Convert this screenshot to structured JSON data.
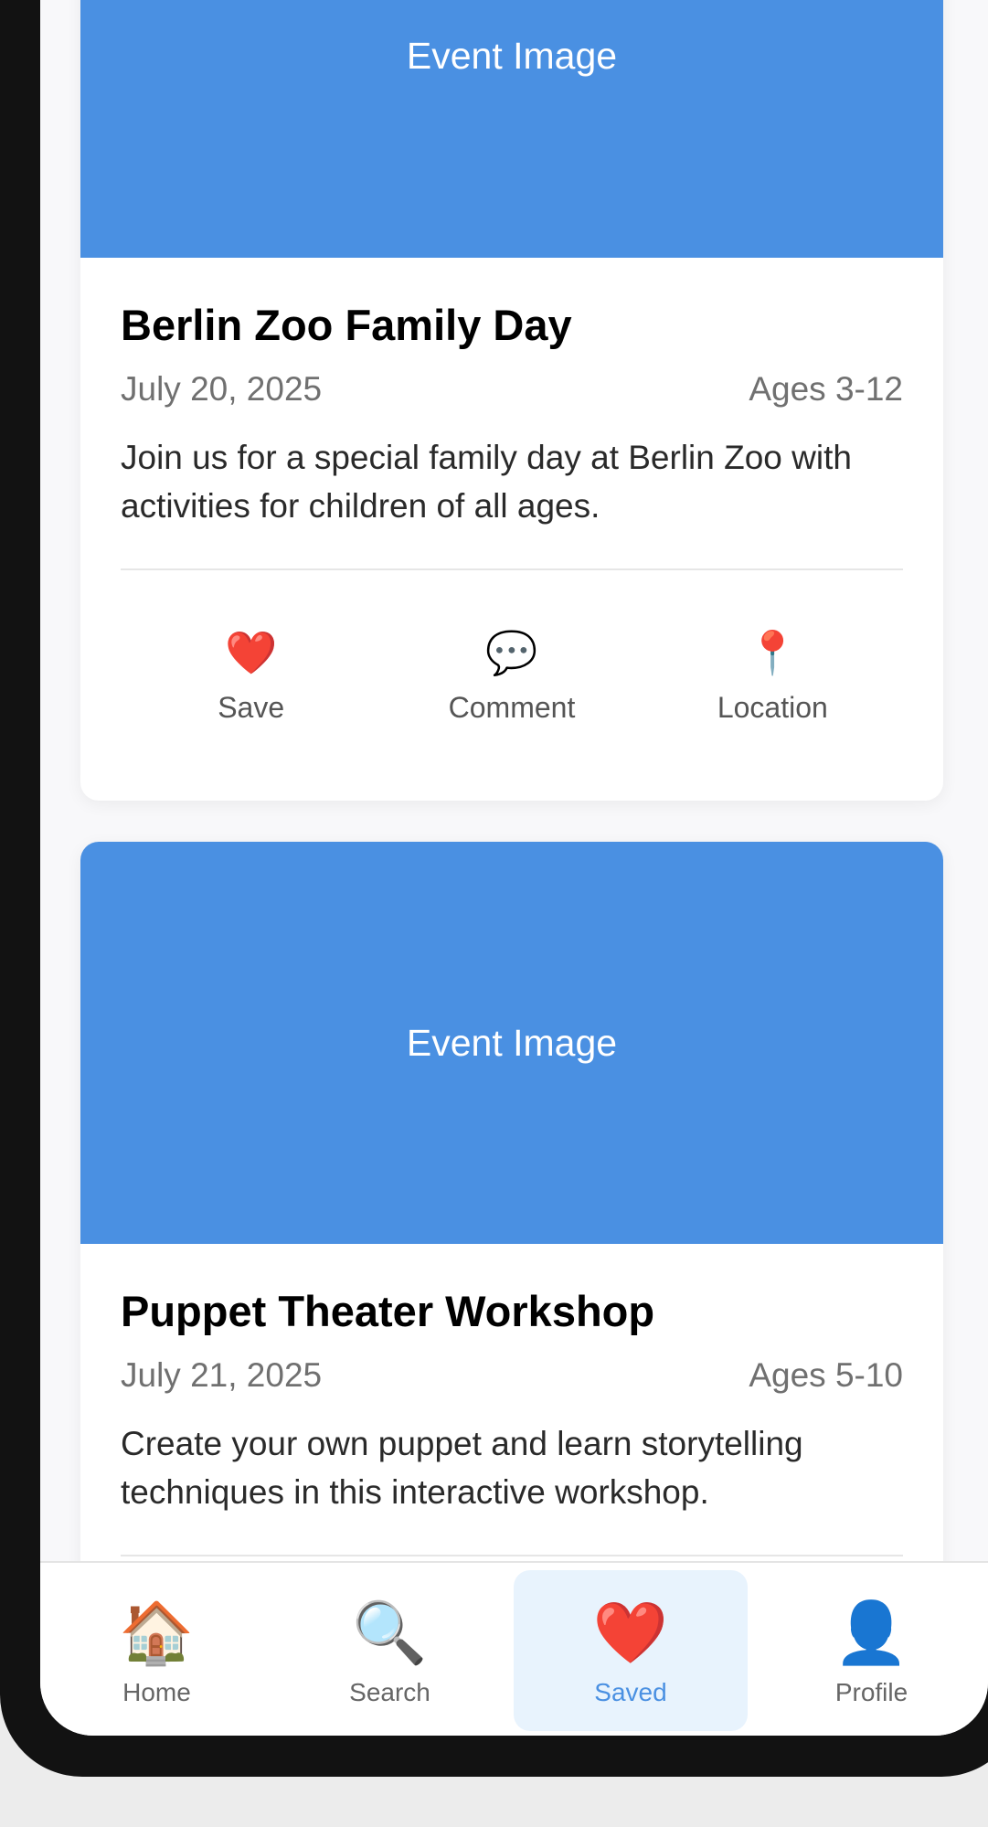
{
  "events": [
    {
      "image_label": "Event Image",
      "title": "Berlin Zoo Family Day",
      "date": "July 20, 2025",
      "ages": "Ages 3-12",
      "description": "Join us for a special family day at Berlin Zoo with activities for children of all ages.",
      "actions": {
        "save": {
          "icon": "❤️",
          "label": "Save"
        },
        "comment": {
          "icon": "💬",
          "label": "Comment"
        },
        "location": {
          "icon": "📍",
          "label": "Location"
        }
      }
    },
    {
      "image_label": "Event Image",
      "title": "Puppet Theater Workshop",
      "date": "July 21, 2025",
      "ages": "Ages 5-10",
      "description": "Create your own puppet and learn storytelling techniques in this interactive workshop."
    }
  ],
  "tabbar": {
    "home": {
      "icon": "🏠",
      "label": "Home"
    },
    "search": {
      "icon": "🔍",
      "label": "Search"
    },
    "saved": {
      "icon": "❤️",
      "label": "Saved"
    },
    "profile": {
      "icon": "👤",
      "label": "Profile"
    }
  },
  "colors": {
    "accent": "#4a90e2",
    "active_tab_bg": "#e8f3fd"
  }
}
